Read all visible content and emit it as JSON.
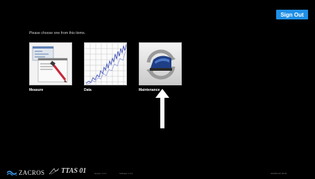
{
  "header": {
    "sign_out_label": "Sign Out"
  },
  "main": {
    "prompt": "Please choose one from this items.",
    "tiles": [
      {
        "label": "Measure",
        "icon": "measure-icon"
      },
      {
        "label": "Data",
        "icon": "data-graph-icon"
      },
      {
        "label": "Maintenance",
        "icon": "maintenance-icon"
      }
    ]
  },
  "footer": {
    "logo_text": "ZACROS",
    "brand_text": "TTAS 01",
    "version_1": "System 1.0.1",
    "version_2": "Software 1.0.0",
    "version_3": "2020/01/10 09:00"
  },
  "colors": {
    "accent": "#1f8fe6",
    "background": "#000000"
  }
}
